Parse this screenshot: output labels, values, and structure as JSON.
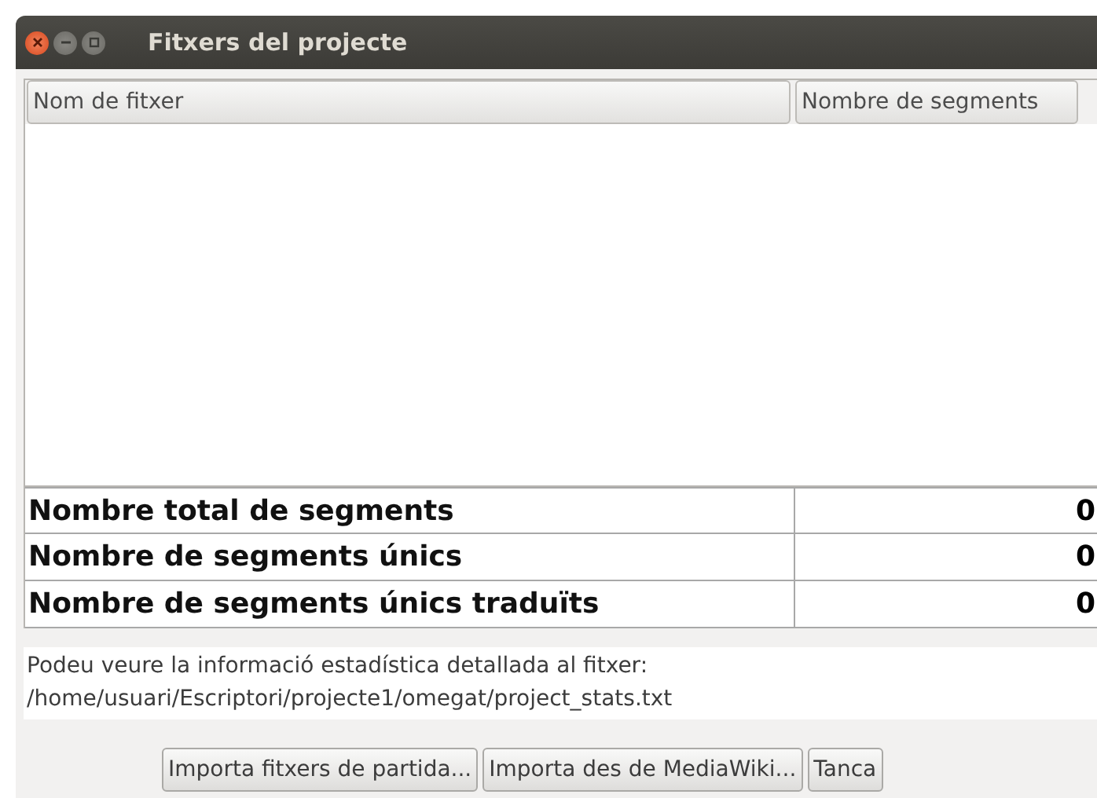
{
  "window": {
    "title": "Fitxers del projecte"
  },
  "table": {
    "columns": [
      "Nom de fitxer",
      "Nombre de segments"
    ]
  },
  "stats": [
    {
      "label": "Nombre total de segments",
      "value": "0"
    },
    {
      "label": "Nombre de segments únics",
      "value": "0"
    },
    {
      "label": "Nombre de segments únics traduïts",
      "value": "0"
    }
  ],
  "info": [
    "Podeu veure la informació estadística detallada al fitxer:",
    "/home/usuari/Escriptori/projecte1/omegat/project_stats.txt"
  ],
  "buttons": [
    "Importa fitxers de partida...",
    "Importa des de MediaWiki...",
    "Tanca"
  ]
}
